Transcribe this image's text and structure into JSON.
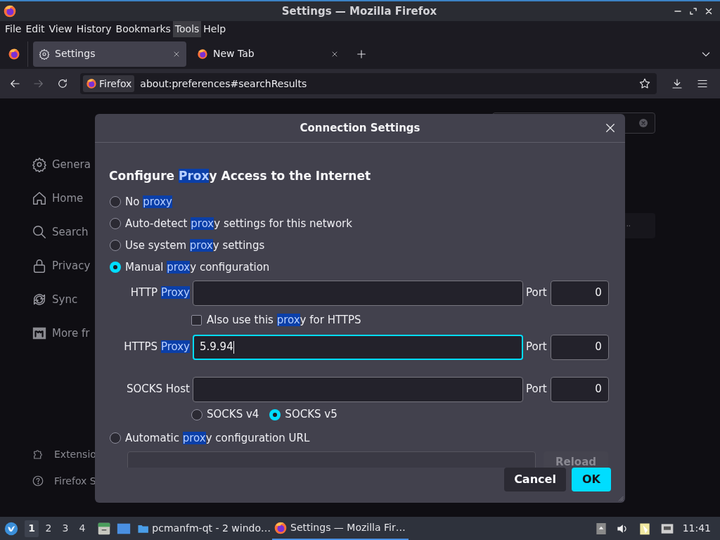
{
  "window": {
    "title": "Settings — Mozilla Firefox"
  },
  "menu": [
    {
      "label": "File",
      "selected": false
    },
    {
      "label": "Edit",
      "selected": false
    },
    {
      "label": "View",
      "selected": false
    },
    {
      "label": "History",
      "selected": false
    },
    {
      "label": "Bookmarks",
      "selected": false
    },
    {
      "label": "Tools",
      "selected": true
    },
    {
      "label": "Help",
      "selected": false
    }
  ],
  "tabs": [
    {
      "label": "Settings",
      "kind": "settings",
      "selected": true
    },
    {
      "label": "New Tab",
      "kind": "firefox",
      "selected": false
    }
  ],
  "navigation": {
    "buttons": [
      {
        "kind": "back",
        "disabled": false
      },
      {
        "kind": "forward",
        "disabled": true
      },
      {
        "kind": "reload",
        "disabled": false
      }
    ],
    "identity": "Firefox",
    "url": "about:preferences#searchResults"
  },
  "sidebar": {
    "items": [
      {
        "label": "Genera",
        "kind": "gear"
      },
      {
        "label": "Home",
        "kind": "home"
      },
      {
        "label": "Search",
        "kind": "search"
      },
      {
        "label": "Privacy",
        "kind": "lock"
      },
      {
        "label": "Sync",
        "kind": "sync"
      },
      {
        "label": "More fr",
        "kind": "m"
      }
    ],
    "footer_items": [
      {
        "label": "Extensio",
        "kind": "puzzle"
      },
      {
        "label": "Firefox S",
        "kind": "help"
      }
    ]
  },
  "dialog": {
    "title": "Connection Settings",
    "heading": [
      {
        "text": "Configure ",
        "highlight": false
      },
      {
        "text": "Prox",
        "highlight": true
      },
      {
        "text": "y Access to the Internet",
        "highlight": false
      }
    ],
    "items": [
      {
        "kind": "radio",
        "selected": false,
        "parts": [
          {
            "text": "No ",
            "highlight": false
          },
          {
            "text": "proxy",
            "highlight": true
          }
        ]
      },
      {
        "kind": "radio",
        "selected": false,
        "parts": [
          {
            "text": "Auto-detect ",
            "highlight": false
          },
          {
            "text": "prox",
            "highlight": true
          },
          {
            "text": "y settings for this network",
            "highlight": false
          }
        ]
      },
      {
        "kind": "radio",
        "selected": false,
        "parts": [
          {
            "text": "Use system ",
            "highlight": false
          },
          {
            "text": "prox",
            "highlight": true
          },
          {
            "text": "y settings",
            "highlight": false
          }
        ]
      },
      {
        "kind": "radio",
        "selected": true,
        "parts": [
          {
            "text": "Manual ",
            "highlight": false
          },
          {
            "text": "prox",
            "highlight": true
          },
          {
            "text": "y configuration",
            "highlight": false
          }
        ]
      },
      {
        "kind": "field",
        "focused": false,
        "value": "",
        "port_label": "Port",
        "port": "0",
        "parts": [
          {
            "text": "HTTP ",
            "highlight": false
          },
          {
            "text": "Proxy",
            "highlight": true
          }
        ]
      },
      {
        "kind": "checkbox",
        "checked": false,
        "parts": [
          {
            "text": "Also use this ",
            "highlight": false
          },
          {
            "text": "prox",
            "highlight": true
          },
          {
            "text": "y for HTTPS",
            "highlight": false
          }
        ]
      },
      {
        "kind": "field",
        "focused": true,
        "value": "5.9.94",
        "port_label": "Port",
        "port": "0",
        "parts": [
          {
            "text": "HTTPS ",
            "highlight": false
          },
          {
            "text": "Proxy",
            "highlight": true
          }
        ]
      },
      {
        "kind": "field",
        "focused": false,
        "value": "",
        "port_label": "Port",
        "port": "0",
        "parts": [
          {
            "text": "SOCKS Host",
            "highlight": false
          }
        ]
      },
      {
        "kind": "versions",
        "options": [
          {
            "label": "SOCKS v4",
            "selected": false
          },
          {
            "label": "SOCKS v5",
            "selected": true
          }
        ]
      },
      {
        "kind": "radio",
        "selected": false,
        "parts": [
          {
            "text": "Automatic ",
            "highlight": false
          },
          {
            "text": "prox",
            "highlight": true
          },
          {
            "text": "y configuration URL",
            "highlight": false
          }
        ]
      },
      {
        "kind": "url",
        "value": "",
        "button": "Reload",
        "disabled": true
      }
    ],
    "buttons": [
      {
        "label": "Cancel",
        "kind": "secondary"
      },
      {
        "label": "OK",
        "kind": "primary"
      }
    ]
  },
  "taskbar": {
    "workspaces": [
      {
        "label": "1",
        "selected": true
      },
      {
        "label": "2",
        "selected": false
      },
      {
        "label": "3",
        "selected": false
      },
      {
        "label": "4",
        "selected": false
      }
    ],
    "tasks": [
      {
        "label": "pcmanfm-qt - 2 windo…",
        "kind": "folder",
        "selected": false
      },
      {
        "label": "Settings — Mozilla Fir…",
        "kind": "firefox",
        "selected": true
      }
    ],
    "clock": "11:41"
  }
}
